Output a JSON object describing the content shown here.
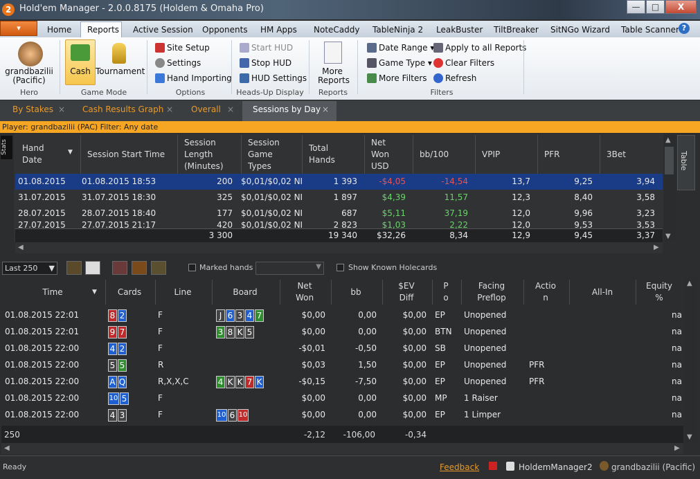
{
  "window": {
    "title": "Hold'em Manager - 2.0.0.8175 (Holdem & Omaha Pro)",
    "app_icon": "2",
    "minimize": "—",
    "maximize": "□",
    "close": "X"
  },
  "menu": {
    "app_button": "▾",
    "tabs": [
      "Home",
      "Reports",
      "Active Session",
      "Opponents",
      "HM Apps",
      "NoteCaddy",
      "TableNinja 2",
      "LeakBuster",
      "TiltBreaker",
      "SitNGo Wizard",
      "Table Scanner 2"
    ],
    "active": "Reports",
    "help": "?"
  },
  "ribbon": {
    "hero": {
      "name": "grandbazilii",
      "site": "(Pacific)",
      "group": "Hero"
    },
    "game_mode": {
      "cash": "Cash",
      "tournament": "Tournament",
      "group": "Game Mode"
    },
    "options": {
      "site_setup": "Site Setup",
      "settings": "Settings",
      "hand_importing": "Hand Importing",
      "group": "Options"
    },
    "hud": {
      "start": "Start HUD",
      "stop": "Stop HUD",
      "settings": "HUD Settings",
      "group": "Heads-Up Display"
    },
    "reports": {
      "more": "More",
      "more2": "Reports",
      "group": "Reports"
    },
    "filters": {
      "date_range": "Date Range",
      "game_type": "Game Type",
      "more_filters": "More Filters",
      "apply_all": "Apply to all Reports",
      "clear": "Clear Filters",
      "refresh": "Refresh",
      "group": "Filters"
    }
  },
  "doc_tabs": [
    "By Stakes",
    "Cash Results Graph",
    "Overall",
    "Sessions by Day"
  ],
  "doc_tab_close": "×",
  "player_bar": "Player: grandbazilii (PAC)   Filter: Any date",
  "upper": {
    "side_stats": "Stats",
    "side_table": "Table",
    "headers": [
      [
        "Hand",
        "Date"
      ],
      [
        "Session Start Time"
      ],
      [
        "Session",
        "Length",
        "(Minutes)"
      ],
      [
        "Session",
        "Game",
        "Types"
      ],
      [
        "Total",
        "Hands"
      ],
      [
        "Net",
        "Won",
        "USD"
      ],
      [
        "bb/100"
      ],
      [
        "VPIP"
      ],
      [
        "PFR"
      ],
      [
        "3Bet"
      ]
    ],
    "rows": [
      [
        "01.08.2015",
        "01.08.2015 18:53",
        "200",
        "$0,01/$0,02 NI",
        "1 393",
        "-$4,05",
        "-14,54",
        "13,7",
        "9,25",
        "3,94"
      ],
      [
        "31.07.2015",
        "31.07.2015 18:30",
        "325",
        "$0,01/$0,02 NI",
        "1 897",
        "$4,39",
        "11,57",
        "12,3",
        "8,40",
        "3,58"
      ],
      [
        "28.07.2015",
        "28.07.2015 18:40",
        "177",
        "$0,01/$0,02 NI",
        "687",
        "$5,11",
        "37,19",
        "12,0",
        "9,96",
        "3,23"
      ],
      [
        "27.07.2015",
        "27.07.2015 21:17",
        "420",
        "$0,01/$0,02 NI",
        "2 823",
        "$1,03",
        "2,22",
        "12,0",
        "9,53",
        "3,53"
      ]
    ],
    "totals": [
      "3 300",
      "19 340",
      "$32,26",
      "8,34",
      "12,9",
      "9,45",
      "3,37"
    ]
  },
  "toolbar": {
    "last": "Last 250",
    "marked_hands": "Marked hands",
    "show_known": "Show Known Holecards"
  },
  "lower": {
    "headers": [
      [
        "Time"
      ],
      [
        "Cards"
      ],
      [
        "Line"
      ],
      [
        "Board"
      ],
      [
        "Net",
        "Won"
      ],
      [
        "bb"
      ],
      [
        "$EV",
        "Diff"
      ],
      [
        "P",
        "o"
      ],
      [
        "Facing",
        "Preflop"
      ],
      [
        "Actio",
        "n"
      ],
      [
        "All-In"
      ],
      [
        "Equity",
        "%"
      ]
    ],
    "rows": [
      {
        "time": "01.08.2015 22:01",
        "cards": [
          [
            "8",
            "r"
          ],
          [
            "2",
            "b"
          ]
        ],
        "line": "F",
        "board": [
          [
            "J",
            "k"
          ],
          [
            "6",
            "b"
          ],
          [
            "3",
            "k"
          ],
          [
            "4",
            "b"
          ],
          [
            "7",
            "g"
          ]
        ],
        "net": "$0,00",
        "bb": "0,00",
        "ev": "$0,00",
        "pos": "EP",
        "facing": "Unopened",
        "action": "",
        "eq": "na"
      },
      {
        "time": "01.08.2015 22:01",
        "cards": [
          [
            "9",
            "r"
          ],
          [
            "7",
            "r"
          ]
        ],
        "line": "F",
        "board": [
          [
            "3",
            "g"
          ],
          [
            "8",
            "k"
          ],
          [
            "K",
            "k"
          ],
          [
            "5",
            "k"
          ]
        ],
        "net": "$0,00",
        "bb": "0,00",
        "ev": "$0,00",
        "pos": "BTN",
        "facing": "Unopened",
        "action": "",
        "eq": "na"
      },
      {
        "time": "01.08.2015 22:00",
        "cards": [
          [
            "4",
            "b"
          ],
          [
            "2",
            "b"
          ]
        ],
        "line": "F",
        "board": [],
        "net": "-$0,01",
        "bb": "-0,50",
        "ev": "$0,00",
        "pos": "SB",
        "facing": "Unopened",
        "action": "",
        "eq": "na"
      },
      {
        "time": "01.08.2015 22:00",
        "cards": [
          [
            "5",
            "k"
          ],
          [
            "5",
            "g"
          ]
        ],
        "line": "R",
        "board": [],
        "net": "$0,03",
        "bb": "1,50",
        "ev": "$0,00",
        "pos": "EP",
        "facing": "Unopened",
        "action": "PFR",
        "eq": "na"
      },
      {
        "time": "01.08.2015 22:00",
        "cards": [
          [
            "A",
            "b"
          ],
          [
            "Q",
            "b"
          ]
        ],
        "line": "R,X,X,C",
        "board": [
          [
            "4",
            "g"
          ],
          [
            "K",
            "k"
          ],
          [
            "K",
            "k"
          ],
          [
            "7",
            "r"
          ],
          [
            "K",
            "b"
          ]
        ],
        "net": "-$0,15",
        "bb": "-7,50",
        "ev": "$0,00",
        "pos": "EP",
        "facing": "Unopened",
        "action": "PFR",
        "eq": "na"
      },
      {
        "time": "01.08.2015 22:00",
        "cards": [
          [
            "10",
            "b"
          ],
          [
            "5",
            "b"
          ]
        ],
        "line": "F",
        "board": [],
        "net": "$0,00",
        "bb": "0,00",
        "ev": "$0,00",
        "pos": "MP",
        "facing": "1 Raiser",
        "action": "",
        "eq": "na"
      },
      {
        "time": "01.08.2015 22:00",
        "cards": [
          [
            "4",
            "k"
          ],
          [
            "3",
            "k"
          ]
        ],
        "line": "F",
        "board": [
          [
            "10",
            "b"
          ],
          [
            "6",
            "k"
          ],
          [
            "10",
            "r"
          ]
        ],
        "net": "$0,00",
        "bb": "0,00",
        "ev": "$0,00",
        "pos": "EP",
        "facing": "1 Limper",
        "action": "",
        "eq": "na"
      }
    ],
    "totals": {
      "count": "250",
      "net": "-2,12",
      "bb": "-106,00",
      "ev": "-0,34"
    }
  },
  "status": {
    "ready": "Ready",
    "feedback": "Feedback",
    "hm2": "HoldemManager2",
    "user": "grandbazilii (Pacific)"
  }
}
